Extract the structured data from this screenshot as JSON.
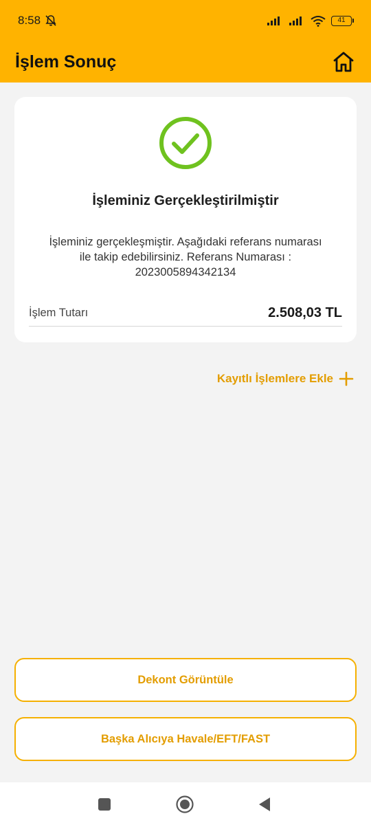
{
  "status_bar": {
    "time": "8:58",
    "battery": "41"
  },
  "header": {
    "title": "İşlem Sonuç"
  },
  "result": {
    "title": "İşleminiz Gerçekleştirilmiştir",
    "description": "İşleminiz gerçekleşmiştir. Aşağıdaki referans numarası ile takip edebilirsiniz. Referans Numarası : 2023005894342134",
    "amount_label": "İşlem Tutarı",
    "amount_value": "2.508,03 TL"
  },
  "add_saved": {
    "label": "Kayıtlı İşlemlere Ekle"
  },
  "actions": {
    "view_receipt": "Dekont Görüntüle",
    "transfer_other": "Başka Alıcıya Havale/EFT/FAST"
  },
  "colors": {
    "brand": "#ffb300",
    "accent": "#e39d00",
    "success": "#6fc21f"
  }
}
